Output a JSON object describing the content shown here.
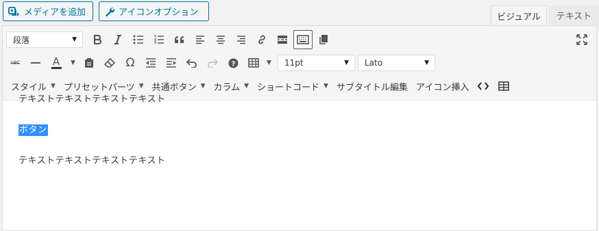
{
  "media_buttons": {
    "add_media": "メディアを追加",
    "icon_options": "アイコンオプション"
  },
  "editor_tabs": {
    "visual": "ビジュアル",
    "text": "テキスト"
  },
  "toolbar": {
    "format_select": "段落",
    "font_size_select": "11pt",
    "font_family_select": "Lato",
    "strikethrough_label": "ABC",
    "text_color_label": "A",
    "menus": [
      {
        "label": "スタイル",
        "dropdown": true
      },
      {
        "label": "プリセットパーツ",
        "dropdown": true
      },
      {
        "label": "共通ボタン",
        "dropdown": true
      },
      {
        "label": "カラム",
        "dropdown": true
      },
      {
        "label": "ショートコード",
        "dropdown": true
      },
      {
        "label": "サブタイトル編集",
        "dropdown": false
      },
      {
        "label": "アイコン挿入",
        "dropdown": false
      }
    ]
  },
  "content": {
    "paragraphs": [
      "テキストテキストテキストテキスト",
      "ボタン",
      "テキストテキストテキストテキスト"
    ]
  },
  "colors": {
    "accent": "#0071a1",
    "selection": "#338fff"
  }
}
